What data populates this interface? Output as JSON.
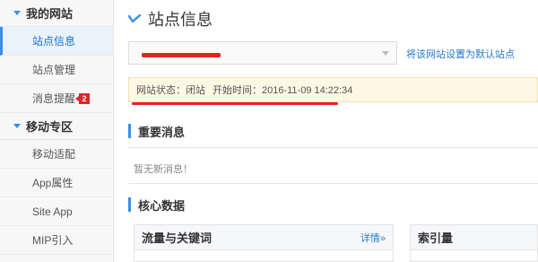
{
  "sidebar": {
    "groups": [
      {
        "label": "我的网站",
        "items": [
          {
            "label": "站点信息"
          },
          {
            "label": "站点管理"
          },
          {
            "label": "消息提醒",
            "badge": "2"
          }
        ]
      },
      {
        "label": "移动专区",
        "items": [
          {
            "label": "移动适配"
          },
          {
            "label": "App属性"
          },
          {
            "label": "Site App"
          },
          {
            "label": "MIP引入"
          }
        ]
      }
    ]
  },
  "header": {
    "title": "站点信息"
  },
  "site_select": {
    "value": ""
  },
  "set_default_link": "将该网站设置为默认站点",
  "status": {
    "state_label": "网站状态：闭站",
    "start_label": "开始时间：2016-11-09 14:22:34"
  },
  "important": {
    "title": "重要消息",
    "empty": "暂无新消息！"
  },
  "core": {
    "title": "核心数据"
  },
  "panels": {
    "traffic": {
      "title": "流量与关键词",
      "link": "详情»"
    },
    "index": {
      "title": "索引量"
    }
  },
  "colors": {
    "accent": "#3a8ee6",
    "redact": "#e8201f",
    "badge": "#e0262b"
  }
}
